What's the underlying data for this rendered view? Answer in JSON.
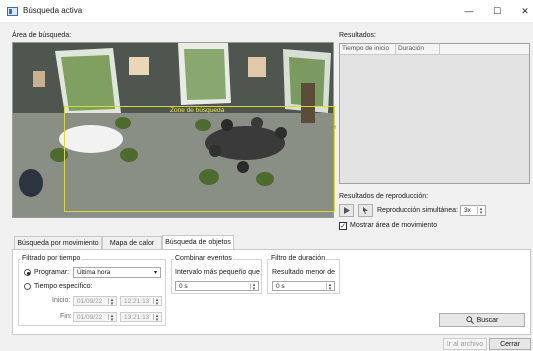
{
  "window": {
    "title": "Búsqueda activa",
    "minimize": "—",
    "maximize": "☐",
    "close": "✕"
  },
  "search_area": {
    "label": "Área de búsqueda:",
    "zone_label": "Zone de búsqueda"
  },
  "results": {
    "label": "Resultados:",
    "columns": [
      "Tiempo de inicio",
      "Duración"
    ]
  },
  "playback": {
    "label": "Resultados de reproducción:",
    "simultaneous_label": "Reproducción simultánea:",
    "speed_value": "3x",
    "show_motion_label": "Mostrar área de movimiento",
    "show_motion_checked": true
  },
  "tabs": [
    {
      "label": "Búsqueda por movimiento",
      "active": false
    },
    {
      "label": "Mapa de calor",
      "active": false
    },
    {
      "label": "Búsqueda de objetos",
      "active": true
    }
  ],
  "time_filter": {
    "legend": "Filtrado por tiempo",
    "programmed_label": "Programar:",
    "programmed_value": "Última hora",
    "specific_label": "Tiempo específico:",
    "start_label": "Inicio:",
    "start_date": "01/09/22",
    "start_time": "12:21:13",
    "end_label": "Fin:",
    "end_date": "01/09/22",
    "end_time": "13:21:13"
  },
  "combine": {
    "legend": "Combinar eventos",
    "label": "Intervalo más pequeño que",
    "value": "0 s"
  },
  "duration_filter": {
    "legend": "Filtro de duración",
    "label": "Resultado menor de",
    "value": "0 s"
  },
  "buttons": {
    "search": "Buscar",
    "go_to_file": "Ir al archivo",
    "close": "Cerrar"
  },
  "colors": {
    "zone_border": "#d8d83a",
    "accent": "#3a6ea5"
  }
}
